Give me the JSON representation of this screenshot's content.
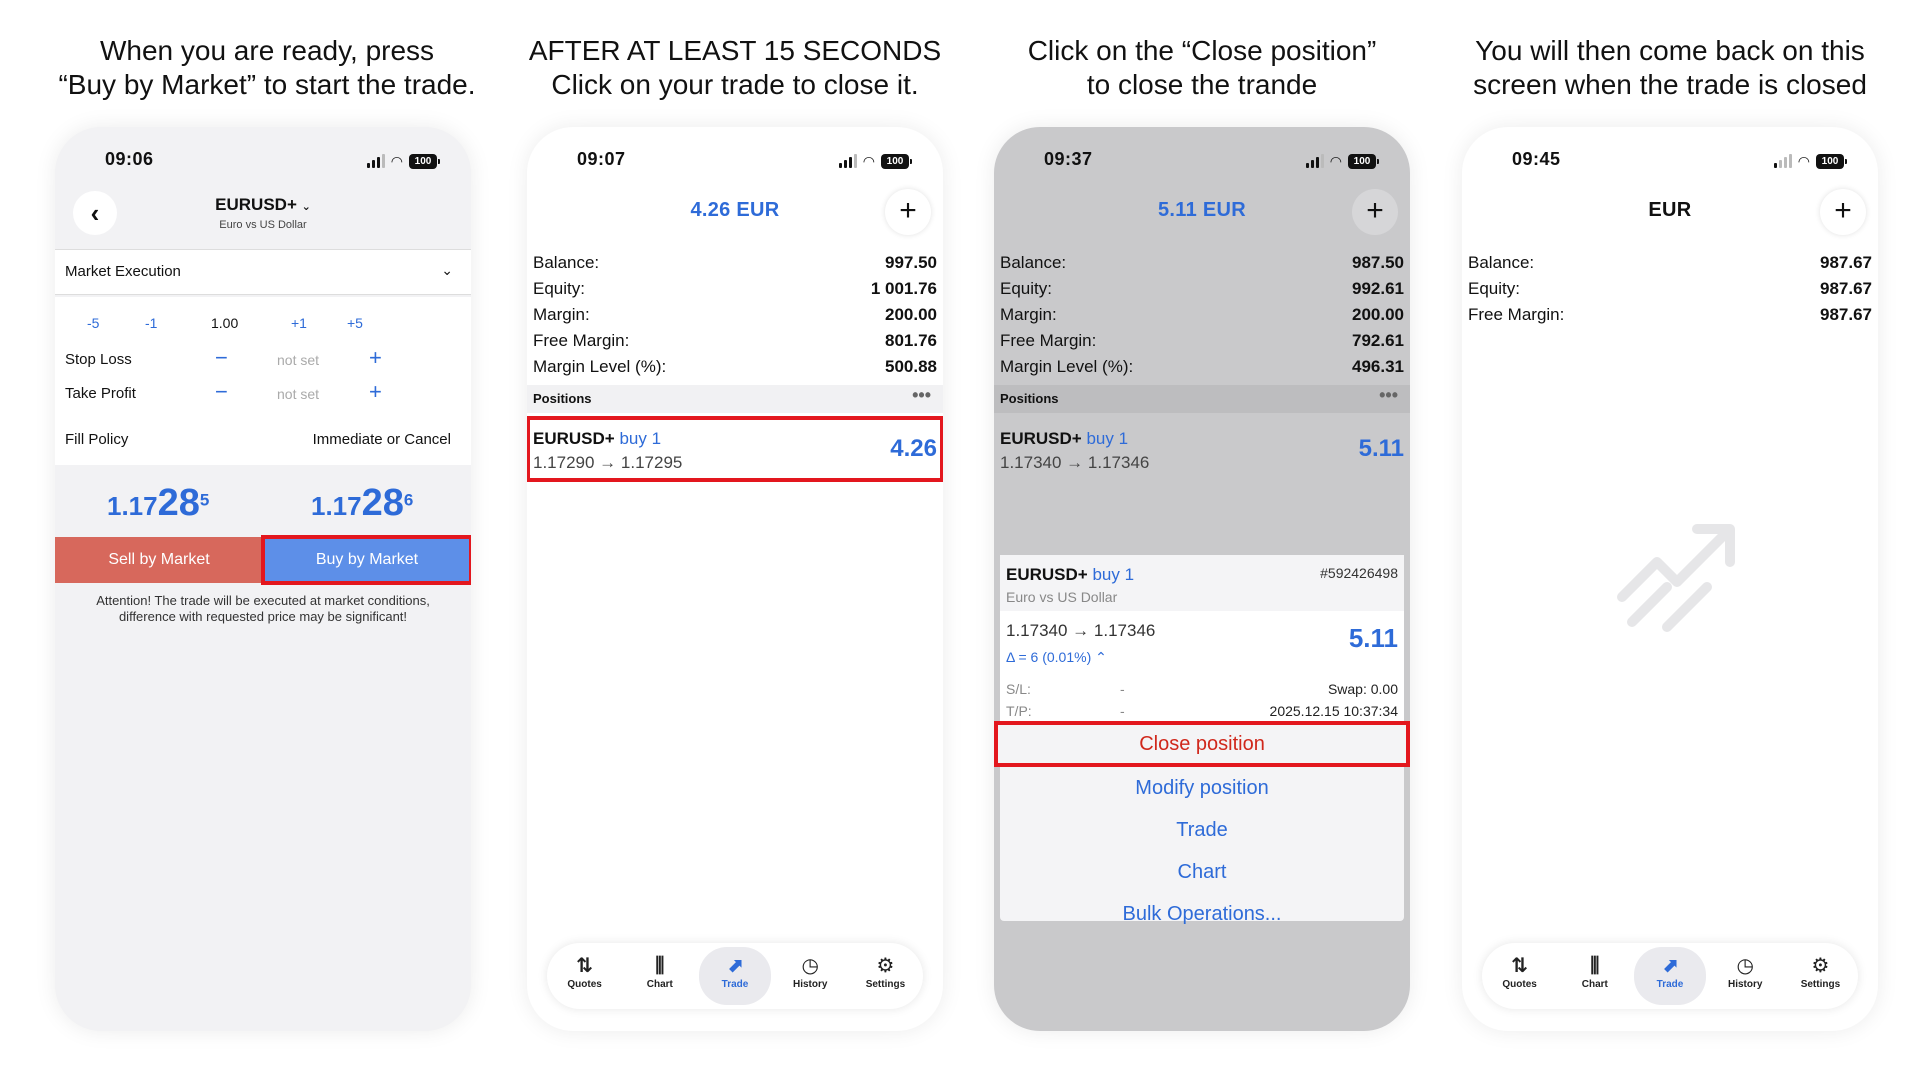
{
  "captions": [
    {
      "line1": "When you are ready, press",
      "line2": "“Buy by Market” to start the trade."
    },
    {
      "line1": "AFTER AT LEAST 15 SECONDS",
      "line2": "Click on your trade to close it."
    },
    {
      "line1": "Click on the “Close position”",
      "line2": "to close the trande"
    },
    {
      "line1": "You will then come back on this",
      "line2": "screen when the trade is closed"
    }
  ],
  "battery": "100",
  "panel1": {
    "time": "09:06",
    "symbol": "EURUSD+",
    "symbol_desc": "Euro vs US Dollar",
    "execution": "Market Execution",
    "volume_steps": [
      "-5",
      "-1",
      "1.00",
      "+1",
      "+5"
    ],
    "stop_loss_label": "Stop Loss",
    "take_profit_label": "Take Profit",
    "not_set": "not set",
    "fill_policy_label": "Fill Policy",
    "fill_policy_value": "Immediate or Cancel",
    "sell_price": {
      "base": "1.17",
      "big": "28",
      "sup": "5"
    },
    "buy_price": {
      "base": "1.17",
      "big": "28",
      "sup": "6"
    },
    "sell_label": "Sell by Market",
    "buy_label": "Buy by Market",
    "attention": "Attention! The trade will be executed at market conditions, difference with requested price may be significant!"
  },
  "panel2": {
    "time": "09:07",
    "header": "4.26 EUR",
    "account": [
      {
        "k": "Balance:",
        "v": "997.50"
      },
      {
        "k": "Equity:",
        "v": "1 001.76"
      },
      {
        "k": "Margin:",
        "v": "200.00"
      },
      {
        "k": "Free Margin:",
        "v": "801.76"
      },
      {
        "k": "Margin Level (%):",
        "v": "500.88"
      }
    ],
    "positions_label": "Positions",
    "position": {
      "symbol": "EURUSD+",
      "dir": "buy 1",
      "prices": "1.17290 → 1.17295",
      "pnl": "4.26"
    }
  },
  "panel3": {
    "time": "09:37",
    "header": "5.11 EUR",
    "account": [
      {
        "k": "Balance:",
        "v": "987.50"
      },
      {
        "k": "Equity:",
        "v": "992.61"
      },
      {
        "k": "Margin:",
        "v": "200.00"
      },
      {
        "k": "Free Margin:",
        "v": "792.61"
      },
      {
        "k": "Margin Level (%):",
        "v": "496.31"
      }
    ],
    "positions_label": "Positions",
    "position": {
      "symbol": "EURUSD+",
      "dir": "buy 1",
      "prices": "1.17340 → 1.17346",
      "pnl": "5.11"
    },
    "sheet": {
      "symbol": "EURUSD+",
      "dir": "buy 1",
      "ticket": "#592426498",
      "desc": "Euro vs US Dollar",
      "prices": "1.17340 → 1.17346",
      "pnl": "5.11",
      "delta": "Δ = 6 (0.01%) ⌃",
      "sl_label": "S/L:",
      "sl_value": "-",
      "tp_label": "T/P:",
      "tp_value": "-",
      "swap": "Swap: 0.00",
      "time": "2025.12.15 10:37:34",
      "actions": [
        "Close position",
        "Modify position",
        "Trade",
        "Chart",
        "Bulk Operations..."
      ]
    }
  },
  "panel4": {
    "time": "09:45",
    "header": "EUR",
    "account": [
      {
        "k": "Balance:",
        "v": "987.67"
      },
      {
        "k": "Equity:",
        "v": "987.67"
      },
      {
        "k": "Free Margin:",
        "v": "987.67"
      }
    ]
  },
  "tabs": [
    "Quotes",
    "Chart",
    "Trade",
    "History",
    "Settings"
  ],
  "colors": {
    "accent": "#2e6bd8",
    "highlight": "#e3171e",
    "sell": "#d7685c",
    "buy": "#5d8fe8",
    "close_text": "#d0281c"
  }
}
